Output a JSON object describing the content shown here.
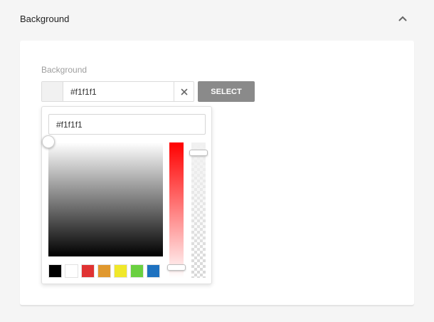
{
  "section": {
    "title": "Background",
    "collapse_icon": "chevron-up-icon"
  },
  "field": {
    "label": "Background",
    "value": "#f1f1f1",
    "clear_icon": "close-icon",
    "select_label": "SELECT"
  },
  "picker": {
    "hex_value": "#f1f1f1",
    "current_color": "#f1f1f1",
    "hue_color": "#ff0000",
    "presets": [
      "#000000",
      "#ffffff",
      "#e03232",
      "#e0982e",
      "#f0e82a",
      "#6ad040",
      "#1e72c0"
    ]
  }
}
